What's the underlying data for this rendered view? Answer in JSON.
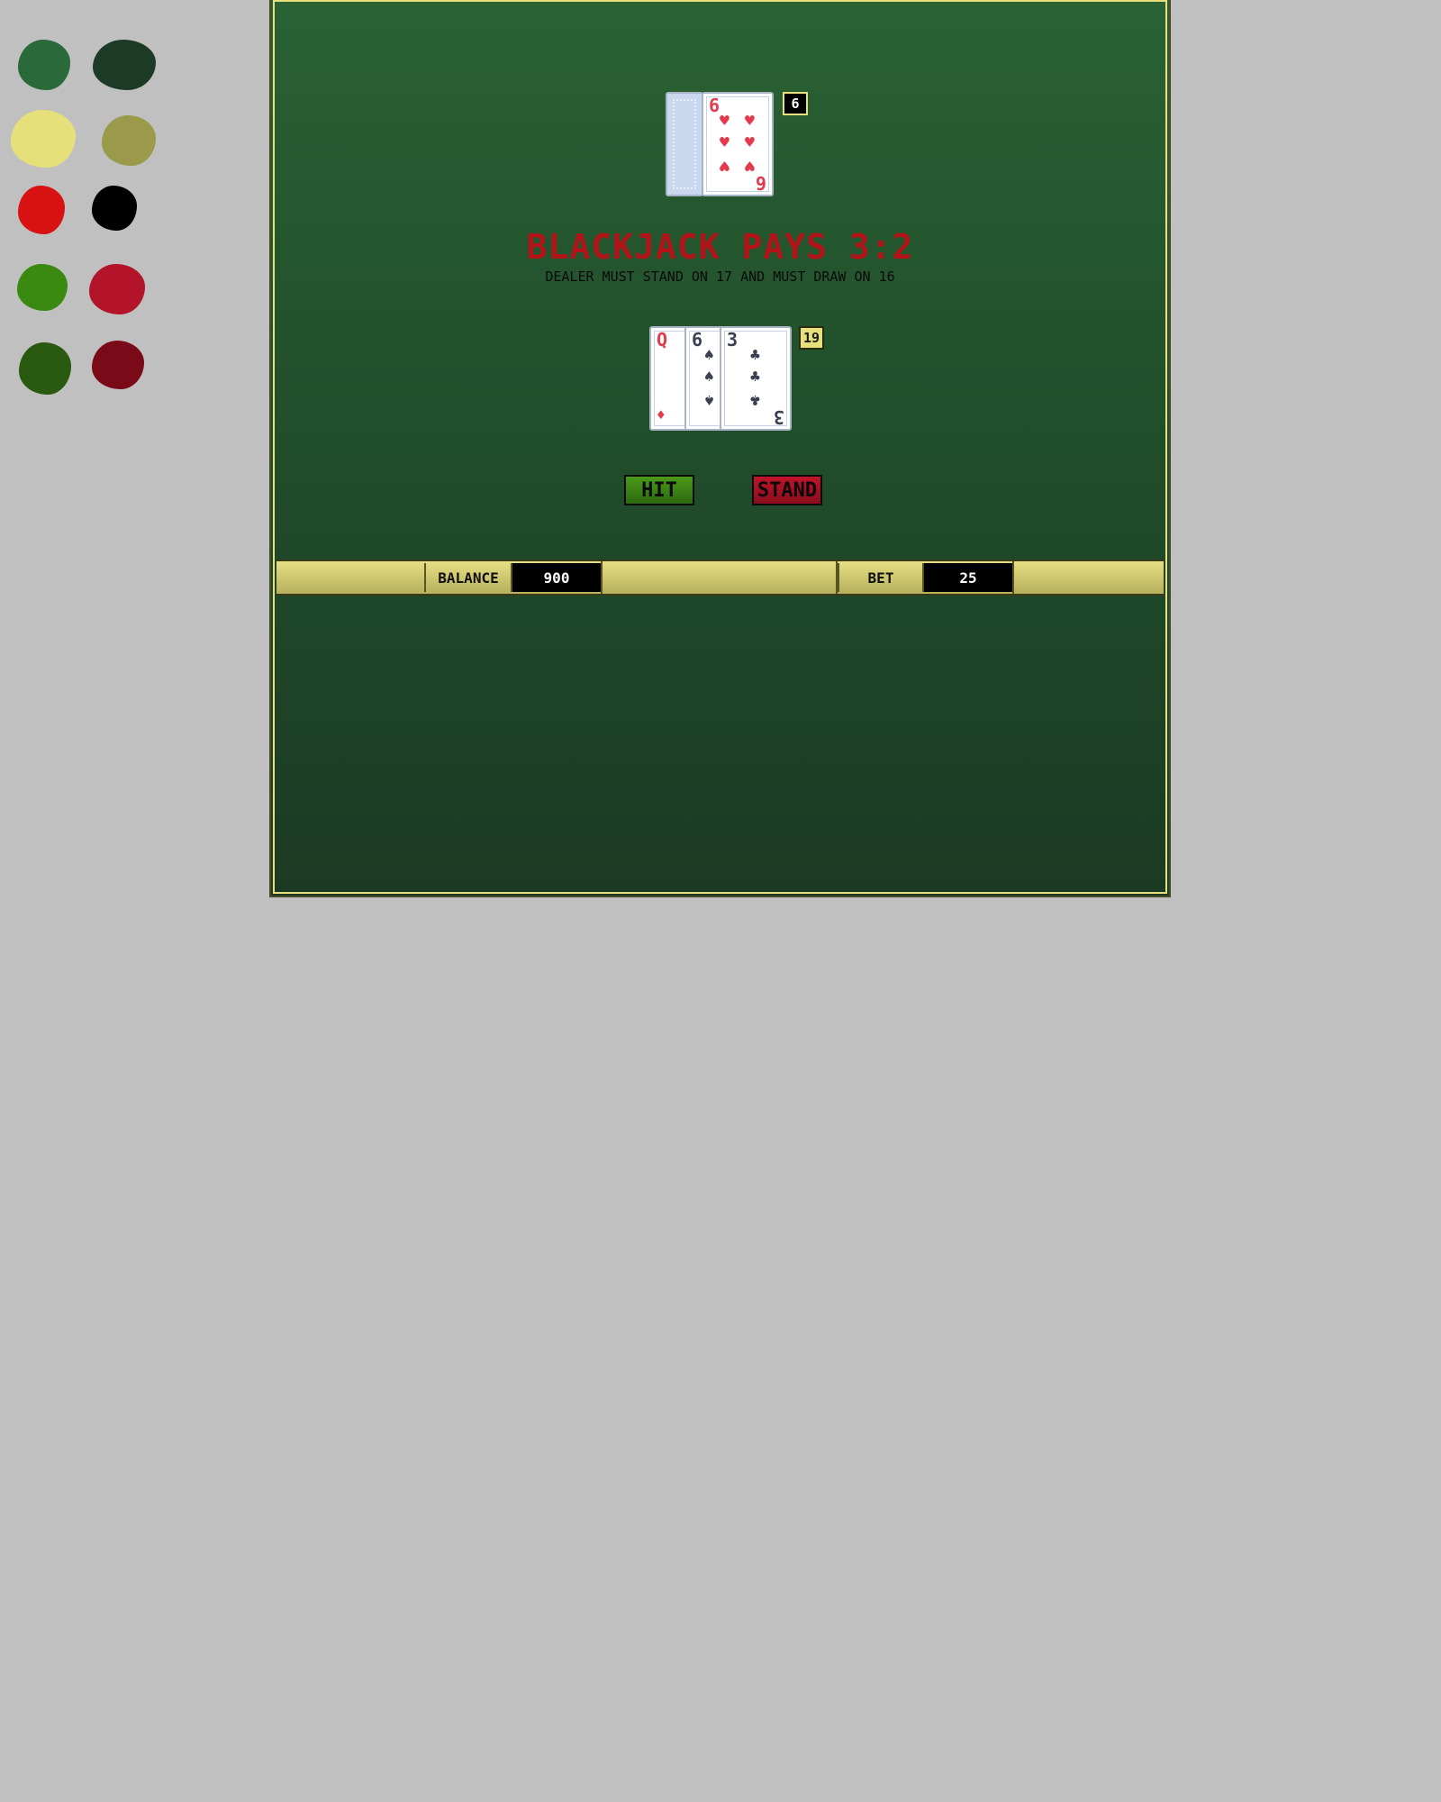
{
  "palette": [
    {
      "name": "table-green",
      "color": "#2a6a3a"
    },
    {
      "name": "table-dark-green",
      "color": "#1d3a26"
    },
    {
      "name": "gold-light",
      "color": "#e6e07a"
    },
    {
      "name": "gold-olive",
      "color": "#9a9a4a"
    },
    {
      "name": "red",
      "color": "#d81212"
    },
    {
      "name": "black",
      "color": "#000000"
    },
    {
      "name": "hit-green",
      "color": "#3a8a12"
    },
    {
      "name": "stand-red",
      "color": "#b3142a"
    },
    {
      "name": "hit-dark-green",
      "color": "#2a5a10"
    },
    {
      "name": "stand-dark-red",
      "color": "#7a0a18"
    }
  ],
  "dealer": {
    "score": "6",
    "up_card": {
      "rank": "6",
      "suit": "♥",
      "color": "red"
    }
  },
  "player": {
    "score": "19",
    "cards": [
      {
        "rank": "Q",
        "suit": "♦",
        "color": "red"
      },
      {
        "rank": "6",
        "suit": "♠",
        "color": "black"
      },
      {
        "rank": "3",
        "suit": "♣",
        "color": "black"
      }
    ]
  },
  "message": {
    "headline": "BLACKJACK PAYS 3:2",
    "rule": "DEALER MUST STAND ON 17 AND MUST DRAW ON 16"
  },
  "actions": {
    "hit_label": "HIT",
    "stand_label": "STAND"
  },
  "status": {
    "balance_label": "BALANCE",
    "balance_value": "900",
    "bet_label": "BET",
    "bet_value": "25"
  }
}
